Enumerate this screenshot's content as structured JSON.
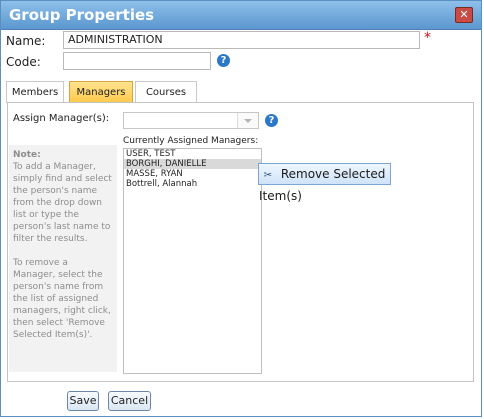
{
  "dialog": {
    "title": "Group Properties",
    "close_glyph": "✕"
  },
  "fields": {
    "name_label": "Name:",
    "name_value": "ADMINISTRATION",
    "required_marker": "*",
    "code_label": "Code:",
    "code_value": "",
    "help_glyph": "?"
  },
  "tabs": [
    {
      "label": "Members",
      "active": false
    },
    {
      "label": "Managers",
      "active": true
    },
    {
      "label": "Courses",
      "active": false
    }
  ],
  "managers": {
    "assign_label": "Assign Manager(s):",
    "assign_value": "",
    "note_heading": "Note:",
    "note_add": "To add a Manager, simply find and select the person's name from the drop down list or type the person's last name to filter the results.",
    "note_remove": "To remove a Manager, select the person's name from the list of assigned managers, right click, then select 'Remove Selected Item(s)'.",
    "current_label": "Currently Assigned Managers:",
    "items": [
      {
        "name": "USER, TEST",
        "selected": false
      },
      {
        "name": "BORGHI, DANIELLE",
        "selected": true
      },
      {
        "name": "MASSE, RYAN",
        "selected": false
      },
      {
        "name": "Bottrell, Alannah",
        "selected": false
      }
    ]
  },
  "context_menu": {
    "icon": "scissors-icon",
    "icon_glyph": "✂",
    "label": "Remove Selected Item(s)"
  },
  "buttons": {
    "save": "Save",
    "cancel": "Cancel"
  },
  "colors": {
    "titlebar": "#6fa7da",
    "active_tab": "#ffc94a",
    "help_icon": "#2a78c7",
    "required": "#d21616"
  }
}
